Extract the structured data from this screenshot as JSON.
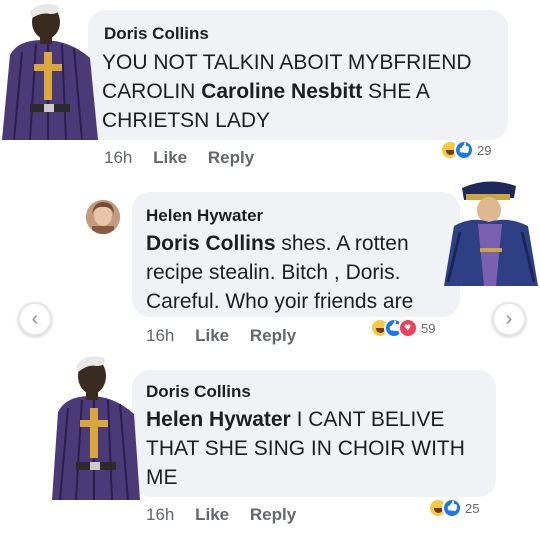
{
  "comments": [
    {
      "author": "Doris Collins",
      "text_line1": "YOU NOT TALKIN ABOIT MYBFRIEND",
      "text_line2_pre": "CAROLIN ",
      "text_line2_mention": "Caroline Nesbitt",
      "text_line2_post": "  SHE A",
      "text_line3": "CHRIETSN LADY",
      "time": "16h",
      "like": "Like",
      "reply": "Reply",
      "reaction_count": "29"
    },
    {
      "author": "Helen Hywater",
      "text_mention": "Doris Collins",
      "text_line1_post": "  shes. A rotten",
      "text_line2": "recipe stealin. Bitch  , Doris.",
      "text_line3": "Careful. Who  yoir friends are",
      "time": "16h",
      "like": "Like",
      "reply": "Reply",
      "reaction_count": "59"
    },
    {
      "author": "Doris Collins",
      "text_mention": "Helen Hywater",
      "text_line1_post": " I CANT BELIVE",
      "text_line2": "THAT SHE SING IN CHOIR WITH",
      "text_line3": "ME",
      "time": "16h",
      "like": "Like",
      "reply": "Reply",
      "reaction_count": "25"
    }
  ],
  "nav": {
    "prev_glyph": "‹",
    "next_glyph": "›"
  },
  "icons": {
    "reactions": [
      "haha-icon",
      "like-icon",
      "love-icon"
    ]
  },
  "colors": {
    "bubble": "#f0f2f5",
    "like_blue": "#1877f2",
    "love_red": "#f33e58",
    "haha_yellow": "#f7c93d",
    "meta_gray": "#65676b"
  }
}
